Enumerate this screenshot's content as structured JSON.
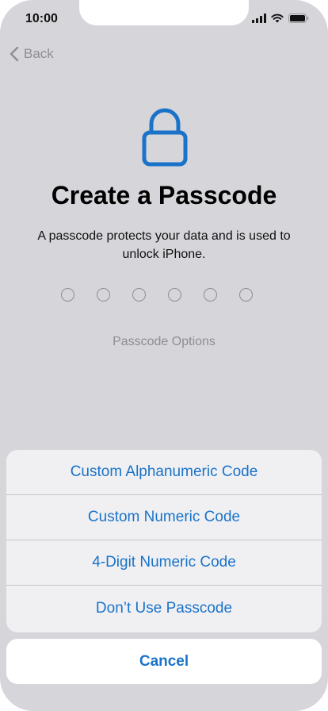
{
  "status_bar": {
    "time": "10:00"
  },
  "nav": {
    "back_label": "Back"
  },
  "header": {
    "title": "Create a Passcode",
    "subtitle": "A passcode protects your data and is used to unlock iPhone."
  },
  "passcode": {
    "digit_count": 6,
    "entered_count": 0
  },
  "options_link": "Passcode Options",
  "action_sheet": {
    "items": [
      {
        "label": "Custom Alphanumeric Code"
      },
      {
        "label": "Custom Numeric Code"
      },
      {
        "label": "4-Digit Numeric Code"
      },
      {
        "label": "Don’t Use Passcode"
      }
    ],
    "cancel_label": "Cancel"
  },
  "colors": {
    "accent": "#1a73c9",
    "background": "#d6d5da",
    "muted": "#8e8e93"
  },
  "icons": {
    "lock": "lock-icon",
    "back": "chevron-left-icon",
    "signal": "cellular-signal-icon",
    "wifi": "wifi-icon",
    "battery": "battery-icon"
  }
}
